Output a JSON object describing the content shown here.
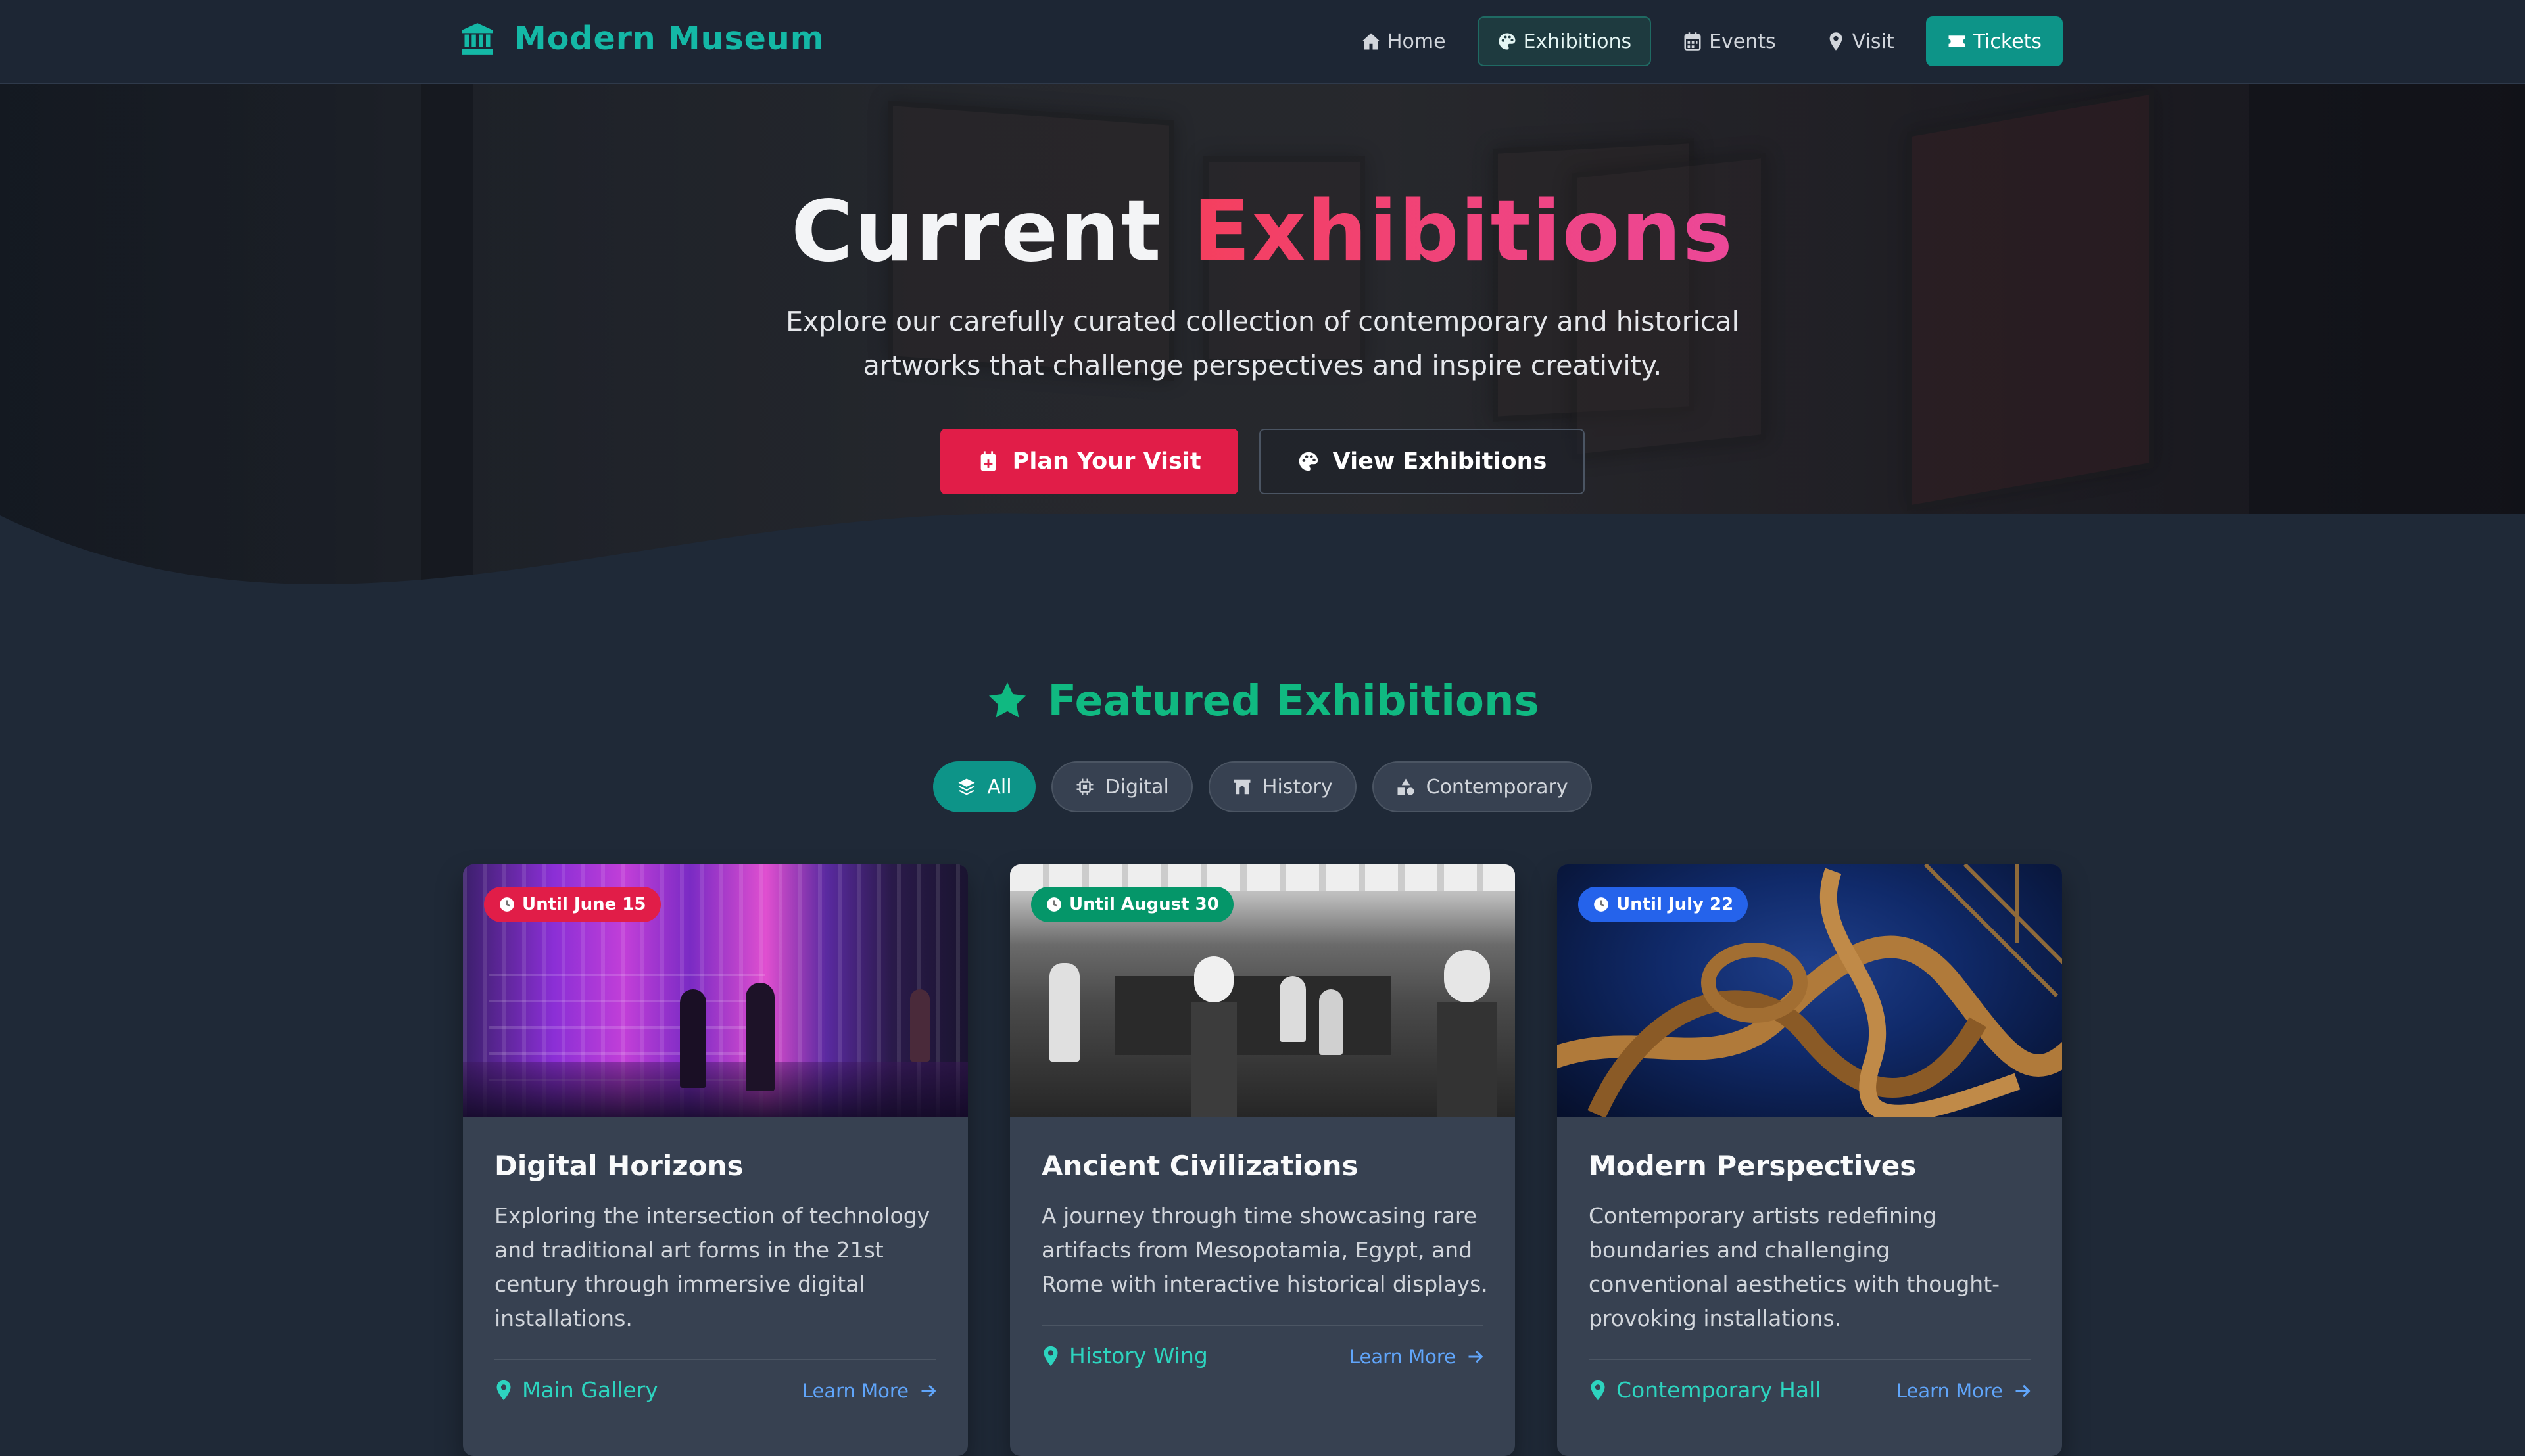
{
  "nav": {
    "brand": "Modern Museum",
    "brand_icon": "museum-icon",
    "links": [
      {
        "label": "Home",
        "icon": "home-icon"
      },
      {
        "label": "Exhibitions",
        "icon": "palette-icon",
        "active": true
      },
      {
        "label": "Events",
        "icon": "calendar-icon"
      },
      {
        "label": "Visit",
        "icon": "map-pin-icon"
      },
      {
        "label": "Tickets",
        "icon": "ticket-icon"
      }
    ]
  },
  "hero": {
    "title_main": "Current",
    "title_accent": "Exhibitions",
    "subtitle": "Explore our carefully curated collection of contemporary and historical artworks that challenge perspectives and inspire creativity.",
    "primary_button": "Plan Your Visit",
    "secondary_button": "View Exhibitions"
  },
  "featured": {
    "title": "Featured Exhibitions",
    "filters": [
      {
        "label": "All",
        "icon": "layers-icon",
        "active": true
      },
      {
        "label": "Digital",
        "icon": "chip-icon"
      },
      {
        "label": "History",
        "icon": "archway-icon"
      },
      {
        "label": "Contemporary",
        "icon": "shapes-icon"
      }
    ]
  },
  "cards": [
    {
      "badge": "Until June 15",
      "badge_color": "#e11d48",
      "title": "Digital Horizons",
      "description": "Exploring the intersection of technology and traditional art forms in the 21st century through immersive digital installations.",
      "location": "Main Gallery",
      "link": "Learn More"
    },
    {
      "badge": "Until August 30",
      "badge_color": "#059669",
      "title": "Ancient Civilizations",
      "description": "A journey through time showcasing rare artifacts from Mesopotamia, Egypt, and Rome with interactive historical displays.",
      "location": "History Wing",
      "link": "Learn More"
    },
    {
      "badge": "Until July 22",
      "badge_color": "#2563eb",
      "title": "Modern Perspectives",
      "description": "Contemporary artists redefining boundaries and challenging conventional aesthetics with thought-provoking installations.",
      "location": "Contemporary Hall",
      "link": "Learn More"
    }
  ]
}
